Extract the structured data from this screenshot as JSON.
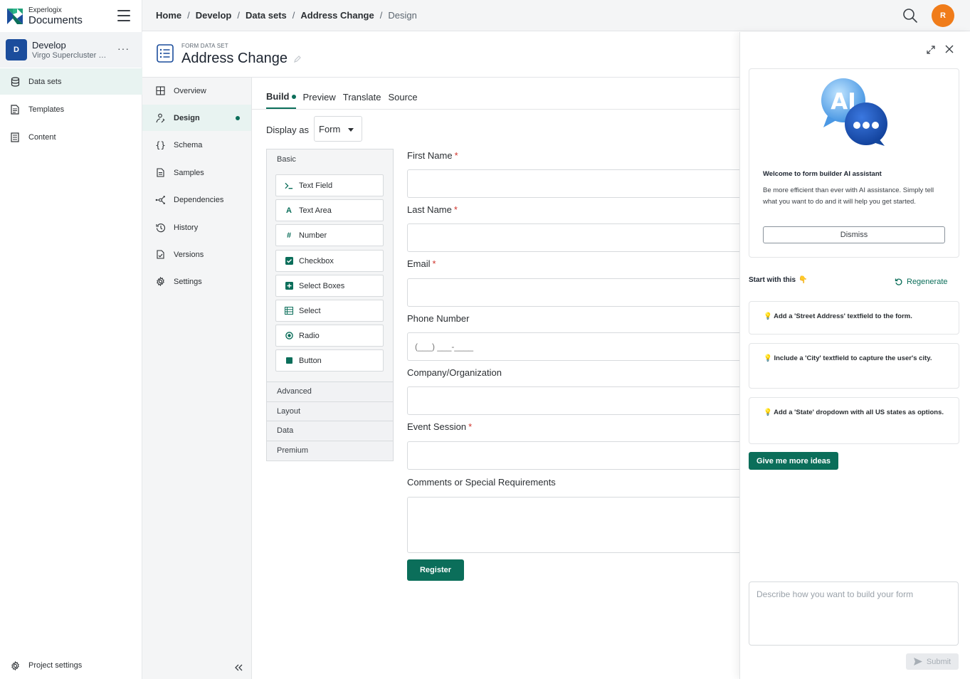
{
  "brand": {
    "line1": "Experlogix",
    "line2": "Documents",
    "colors": [
      "#1f9e78",
      "#1b4d9c",
      "#0b6e5a"
    ]
  },
  "project": {
    "avatar": "D",
    "name": "Develop",
    "subtitle": "Virgo Supercluster Workspace",
    "more_label": "···"
  },
  "sidebar": {
    "items": [
      {
        "label": "Data sets",
        "icon": "database-icon",
        "active": true
      },
      {
        "label": "Templates",
        "icon": "document-icon",
        "active": false
      },
      {
        "label": "Content",
        "icon": "content-icon",
        "active": false
      }
    ],
    "footer": {
      "label": "Project settings",
      "icon": "gear-icon"
    }
  },
  "topbar": {
    "breadcrumb": [
      "Home",
      "Develop",
      "Data sets",
      "Address Change",
      "Design"
    ],
    "separator": "/",
    "user_initial": "R",
    "user_color": "#f07c1a"
  },
  "header": {
    "type": "FORM DATA SET",
    "title": "Address Change"
  },
  "subnav": {
    "items": [
      {
        "label": "Overview",
        "icon": "grid-icon"
      },
      {
        "label": "Design",
        "icon": "design-icon",
        "active": true
      },
      {
        "label": "Schema",
        "icon": "braces-icon"
      },
      {
        "label": "Samples",
        "icon": "file-icon"
      },
      {
        "label": "Dependencies",
        "icon": "network-icon"
      },
      {
        "label": "History",
        "icon": "history-icon"
      },
      {
        "label": "Versions",
        "icon": "versions-icon"
      },
      {
        "label": "Settings",
        "icon": "settings-icon"
      }
    ]
  },
  "tabs": [
    "Build",
    "Preview",
    "Translate",
    "Source"
  ],
  "display_as": {
    "label": "Display as",
    "value": "Form"
  },
  "palette": {
    "groups": [
      "Basic",
      "Advanced",
      "Layout",
      "Data",
      "Premium"
    ],
    "basic": [
      {
        "label": "Text Field",
        "icon": "terminal-icon"
      },
      {
        "label": "Text Area",
        "icon": "font-icon"
      },
      {
        "label": "Number",
        "icon": "hash-icon"
      },
      {
        "label": "Checkbox",
        "icon": "checkbox-icon"
      },
      {
        "label": "Select Boxes",
        "icon": "plus-square-icon"
      },
      {
        "label": "Select",
        "icon": "list-icon"
      },
      {
        "label": "Radio",
        "icon": "radio-icon"
      },
      {
        "label": "Button",
        "icon": "stop-icon"
      }
    ]
  },
  "form": {
    "fields": [
      {
        "label": "First Name",
        "required": true,
        "placeholder": ""
      },
      {
        "label": "Last Name",
        "required": true,
        "placeholder": ""
      },
      {
        "label": "Email",
        "required": true,
        "placeholder": ""
      },
      {
        "label": "Phone Number",
        "required": false,
        "placeholder": "(___) ___-____"
      },
      {
        "label": "Company/Organization",
        "required": false,
        "placeholder": ""
      },
      {
        "label": "Event Session",
        "required": true,
        "placeholder": ""
      },
      {
        "label": "Comments or Special Requirements",
        "required": false,
        "placeholder": ""
      }
    ],
    "required_mark": "*",
    "submit_label": "Register"
  },
  "ai": {
    "welcome_title": "Welcome to form builder AI assistant",
    "welcome_text": "Be more efficient than ever with AI assistance. Simply tell what you want to do and it will help you get started.",
    "dismiss_label": "Dismiss",
    "illustration_text": "AI",
    "start_label": "Start with this",
    "start_emoji": "👇",
    "regenerate_label": "Regenerate",
    "ideas": [
      "Add a 'Street Address' textfield to the form.",
      "Include a 'City' textfield to capture the user's city.",
      "Add a 'State' dropdown with all US states as options."
    ],
    "idea_emoji": "💡",
    "more_ideas_label": "Give me more ideas",
    "input_placeholder": "Describe how you want to build your form",
    "submit_label": "Submit"
  }
}
